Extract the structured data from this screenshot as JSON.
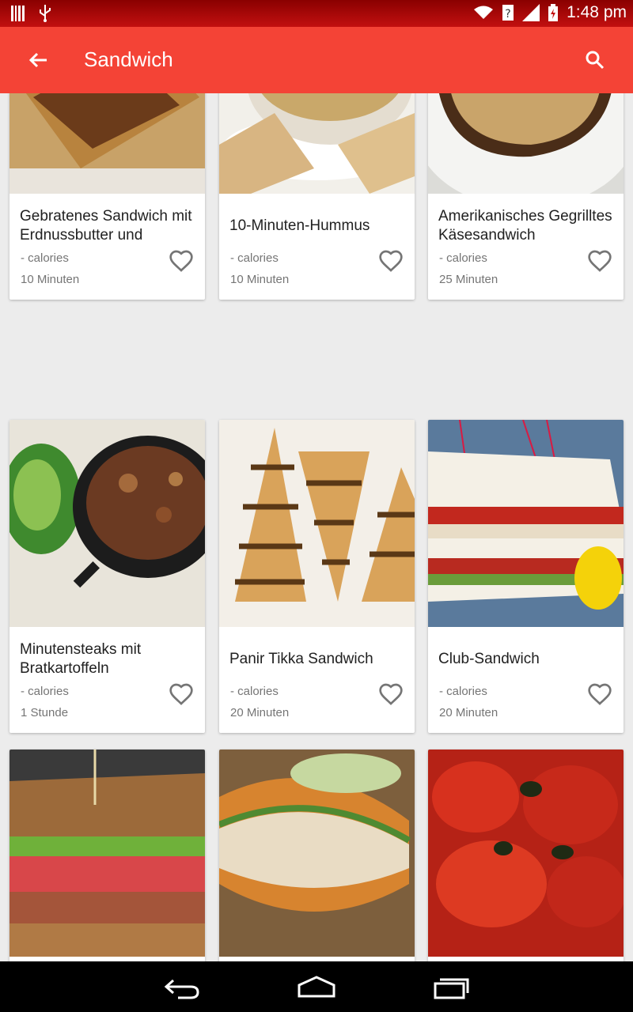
{
  "status_bar": {
    "time": "1:48 pm"
  },
  "app_bar": {
    "title": "Sandwich",
    "background": "#f44336"
  },
  "recipes": [
    {
      "name": "Gebratenes Sandwich mit Erdnussbutter und",
      "calories": "- calories",
      "time": "10 Minuten"
    },
    {
      "name": "10-Minuten-Hummus",
      "calories": "- calories",
      "time": "10 Minuten"
    },
    {
      "name": "Amerikanisches Gegrilltes Käsesandwich",
      "calories": "- calories",
      "time": "25 Minuten"
    },
    {
      "name": "Minutensteaks mit Bratkartoffeln",
      "calories": "- calories",
      "time": "1 Stunde"
    },
    {
      "name": "Panir Tikka Sandwich",
      "calories": "- calories",
      "time": "20 Minuten"
    },
    {
      "name": "Club-Sandwich",
      "calories": "- calories",
      "time": "20 Minuten"
    },
    {
      "name": "",
      "calories": "",
      "time": ""
    },
    {
      "name": "",
      "calories": "",
      "time": ""
    },
    {
      "name": "",
      "calories": "",
      "time": ""
    }
  ]
}
